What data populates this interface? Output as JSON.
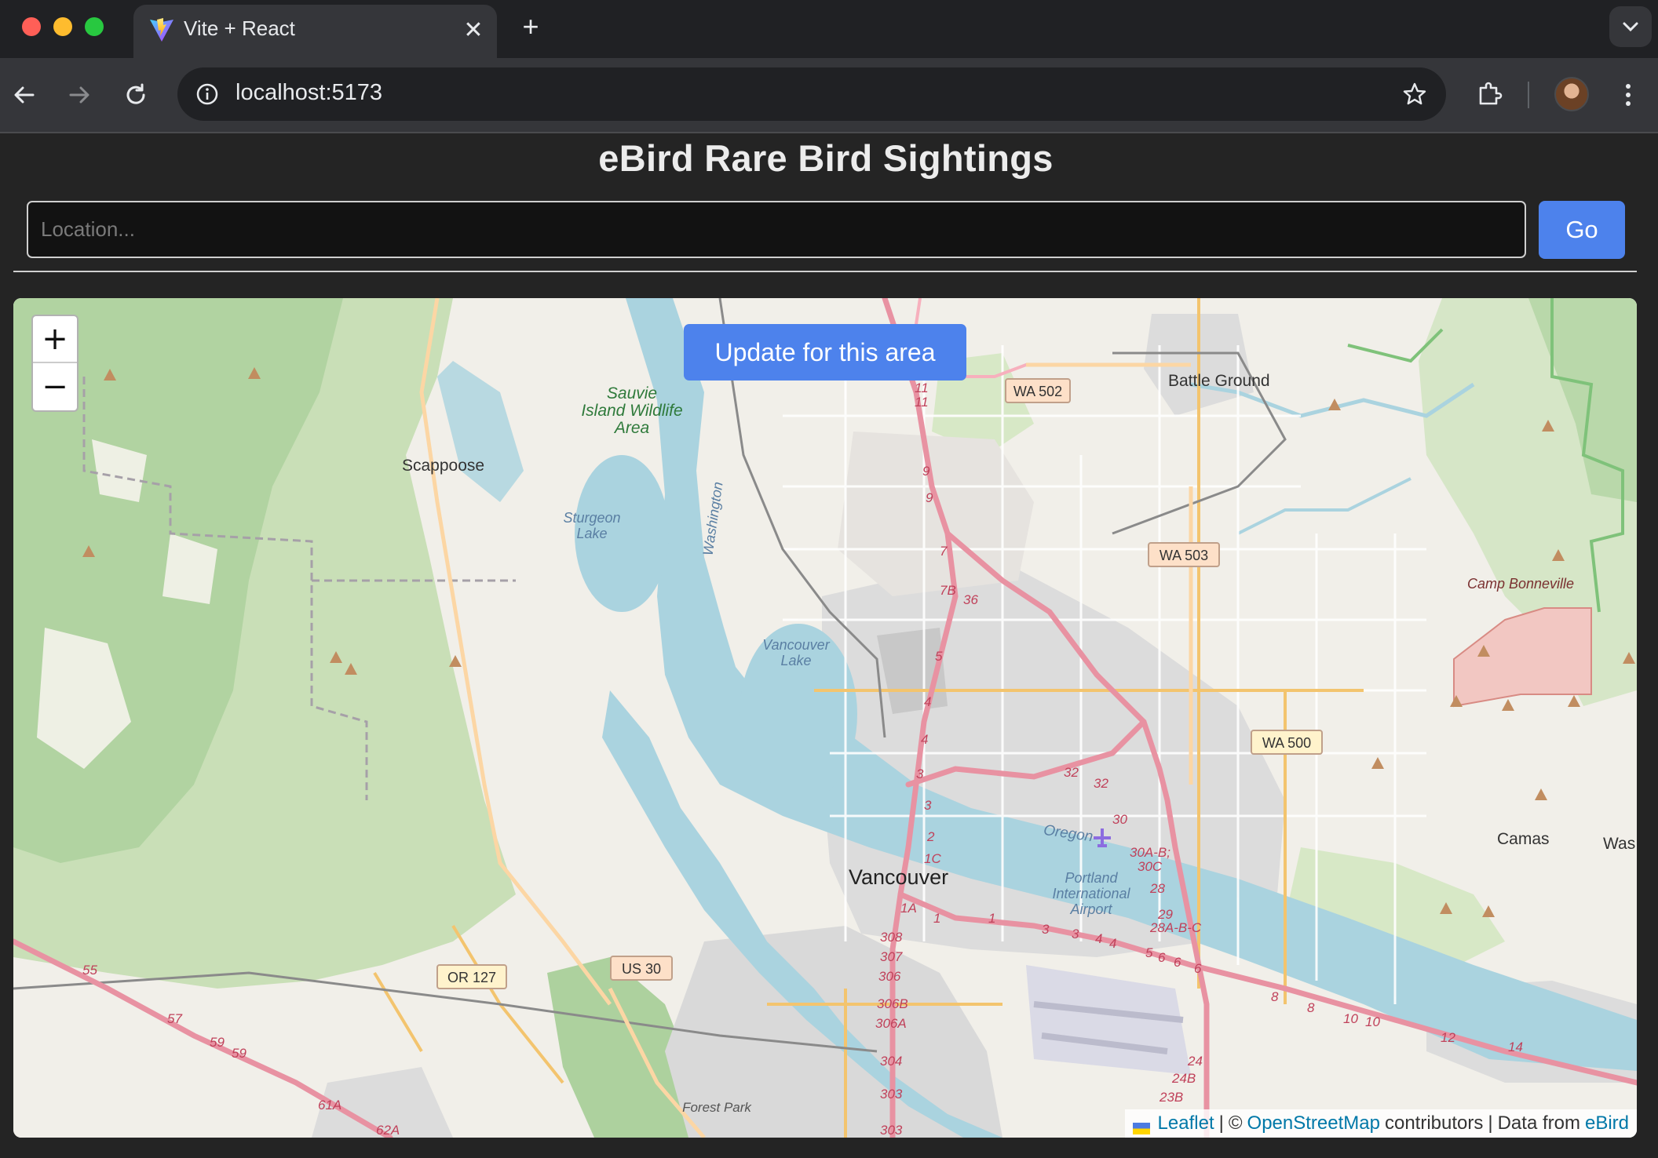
{
  "browser": {
    "tab_title": "Vite + React",
    "url": "localhost:5173"
  },
  "page": {
    "title": "eBird Rare Bird Sightings",
    "location_placeholder": "Location...",
    "go_label": "Go"
  },
  "map": {
    "update_label": "Update for this area",
    "zoom_in": "+",
    "zoom_out": "−",
    "attribution": {
      "leaflet": "Leaflet",
      "separator1": "|",
      "copyright": "©",
      "osm": "OpenStreetMap",
      "contributors": "contributors",
      "separator2": "|",
      "data_from": "Data from",
      "ebird": "eBird"
    },
    "place_labels": [
      "Battle Ground",
      "Scappoose",
      "Sauvie",
      "Island Wildlife",
      "Area",
      "Sturgeon",
      "Lake",
      "Washington",
      "Vancouver",
      "Lake",
      "Vancouver",
      "Camp Bonneville",
      "Oregon",
      "Portland",
      "International",
      "Airport",
      "Camas",
      "Was",
      "Forest Park"
    ],
    "route_shields": [
      "WA 502",
      "WA 503",
      "WA 500",
      "OR 127",
      "US 30"
    ],
    "exit_numbers": [
      "11",
      "11",
      "9",
      "9",
      "7",
      "7B",
      "36",
      "5",
      "4",
      "4",
      "3",
      "3",
      "2",
      "1C",
      "1A",
      "1",
      "1",
      "3",
      "3",
      "4",
      "4",
      "5",
      "6",
      "6",
      "6",
      "8",
      "8",
      "10",
      "10",
      "12",
      "14",
      "32",
      "32",
      "30",
      "30A-B;",
      "30C",
      "28",
      "29",
      "28A-B-C",
      "308",
      "307",
      "306",
      "306B",
      "306A",
      "304",
      "303",
      "303",
      "24",
      "24B",
      "23B",
      "55",
      "57",
      "59",
      "59",
      "61A",
      "62A"
    ],
    "colors": {
      "land": "#f1efe9",
      "forest": "#add19e",
      "water": "#aad3df",
      "urban": "#dcdcdc",
      "motorway": "#e892a2",
      "accent_button": "#4d82ec"
    }
  }
}
